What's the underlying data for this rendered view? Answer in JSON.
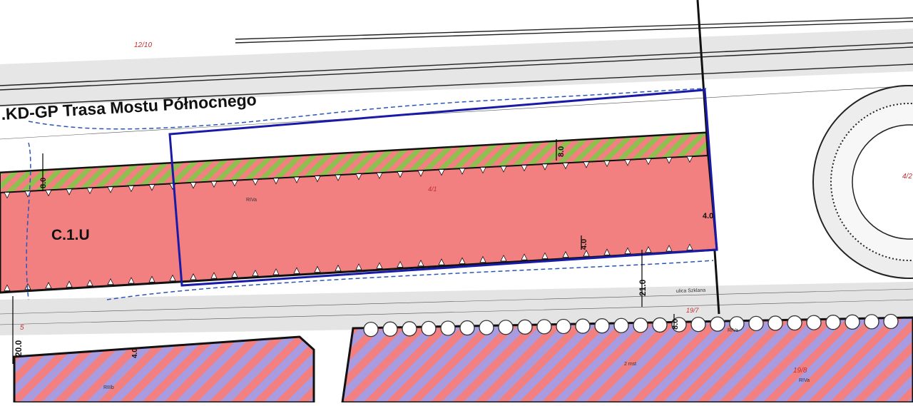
{
  "map": {
    "road_label": ".KD-GP Trasa Mostu Północnego",
    "zone_label": "C.1.U",
    "street_label": "ulica Szklana",
    "parcels": [
      "12/10",
      "4/1",
      "19/7",
      "19/8",
      "4/2",
      "5"
    ],
    "dimensions": [
      "8.0",
      "8.0",
      "4.0",
      "4.0",
      "21.0",
      "20.0",
      "8.0",
      "4.0"
    ],
    "small_labels": [
      "RIVa",
      "RIIIb",
      "RIVa",
      "RIVa",
      "2 mst"
    ],
    "colors": {
      "zone_fill": "#f28080",
      "green_hatch": "#8fbf4f",
      "purple_hatch": "#a99be0",
      "blue_boundary": "#1a1aa8",
      "parcel_text": "#c03030",
      "gray_road": "#e3e3e3"
    }
  }
}
